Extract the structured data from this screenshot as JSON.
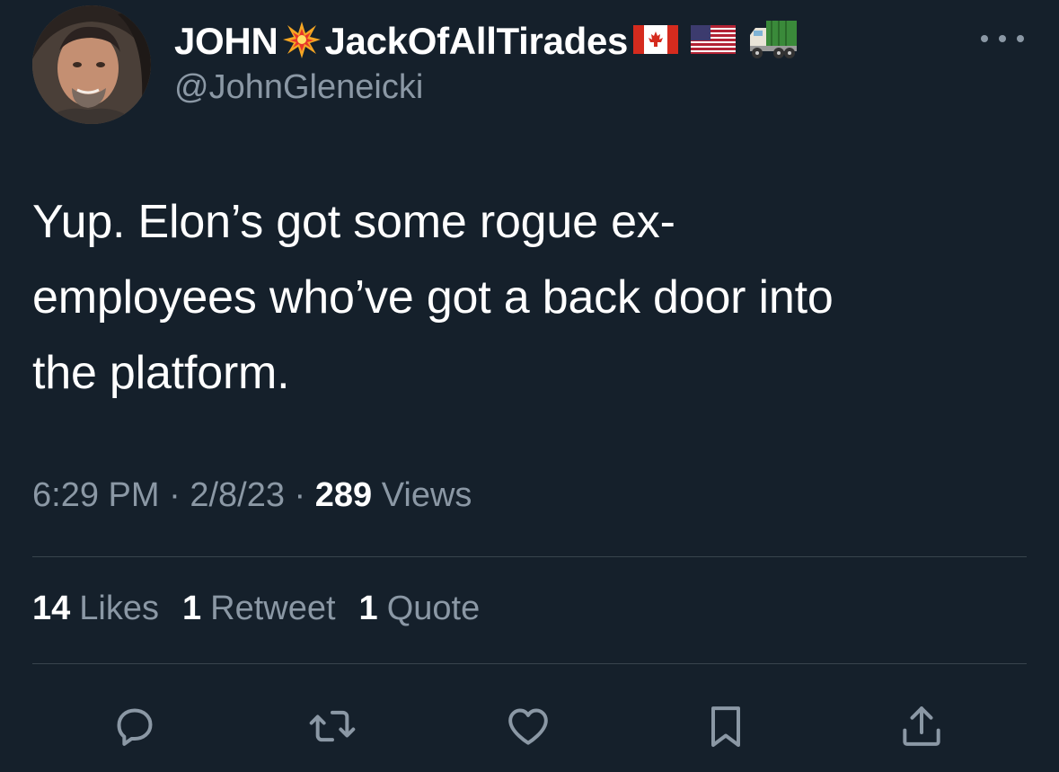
{
  "author": {
    "name": "JOHN",
    "name_part_2": "JackOfAllTirades",
    "handle": "@JohnGleneicki",
    "badges": [
      "collision-emoji",
      "canada-flag-emoji",
      "us-flag-emoji",
      "truck-emoji"
    ]
  },
  "tweet": {
    "text": "Yup. Elon’s got some rogue ex-employees who’ve got a back door into the platform.",
    "line1": "Yup. Elon’s got some rogue ex-",
    "line2": "employees who’ve got a back door into",
    "line3": "the platform."
  },
  "meta": {
    "time": "6:29 PM",
    "sep1": " · ",
    "date": "2/8/23",
    "sep2": " · ",
    "views_count": "289",
    "views_label": " Views"
  },
  "stats": [
    {
      "count": "14",
      "label": "Likes"
    },
    {
      "count": "1",
      "label": "Retweet"
    },
    {
      "count": "1",
      "label": "Quote"
    }
  ],
  "actions": [
    "reply-icon",
    "retweet-icon",
    "like-icon",
    "bookmark-icon",
    "share-icon"
  ],
  "colors": {
    "background": "#15202b",
    "text_primary": "#ffffff",
    "text_secondary": "#8b98a5",
    "divider": "#38444d"
  }
}
